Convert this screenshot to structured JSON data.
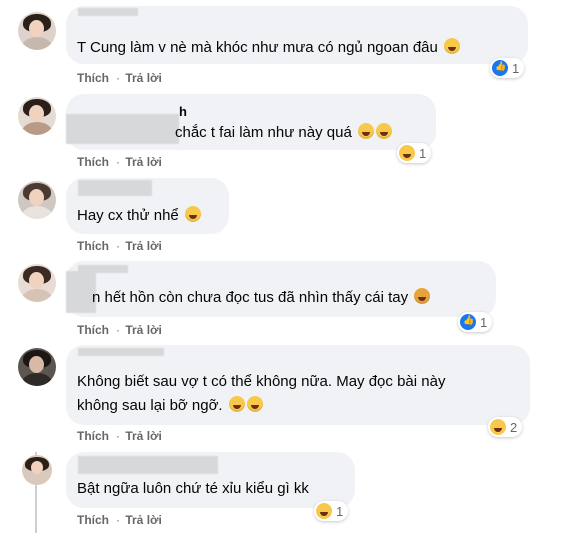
{
  "actions": {
    "like": "Thích",
    "reply": "Trả lời",
    "dot": "·"
  },
  "comments": [
    {
      "name_visible": "",
      "text": "T Cung làm v nè mà khóc như mưa có ngủ ngoan đâu",
      "reaction": {
        "type": "like",
        "count": "1"
      }
    },
    {
      "name_visible": "h",
      "text": "chắc t fai làm như này quá",
      "reaction": {
        "type": "haha",
        "count": "1"
      }
    },
    {
      "name_visible": "",
      "text": "Hay cx thử nhể",
      "reaction": null
    },
    {
      "name_visible": "",
      "text": "n hết hồn còn chưa đọc tus đã nhìn thấy cái tay",
      "reaction": {
        "type": "like",
        "count": "1"
      }
    },
    {
      "name_visible": "",
      "text_line1": "Không biết sau vợ t có thể không nữa. May đọc bài này",
      "text_line2": "không sau lại bỡ ngỡ.",
      "reaction": {
        "type": "haha",
        "count": "2"
      }
    },
    {
      "name_visible": "",
      "text": "Bật ngữa luôn chứ té xỉu kiểu gì kk",
      "reaction": {
        "type": "haha",
        "count": "1"
      }
    }
  ],
  "icons": [
    "like-icon",
    "haha-icon",
    "smile-emoji-icon"
  ],
  "colors": {
    "bubble": "#f0f2f5",
    "like": "#1877f2",
    "meta": "#65676b"
  }
}
